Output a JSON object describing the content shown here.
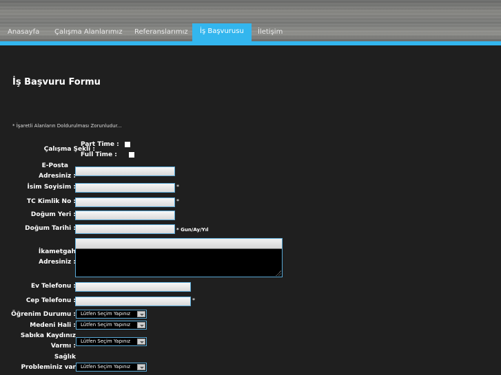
{
  "nav": {
    "items": [
      "Anasayfa",
      "Çalışma Alanlarımız",
      "Referanslarımız",
      "İş Başvurusu",
      "İletişim"
    ]
  },
  "form": {
    "title": "İş Başvuru Formu",
    "required_note": "* İşaretli Alanların Doldurulması Zorunludur...",
    "labels": {
      "calisma_sekli": "Çalışma Şekli :",
      "part_time": "Part Time  :",
      "full_time": "Full Time   :",
      "eposta_1": "E-Posta",
      "eposta_2": "Adresiniz :",
      "isim": "İsim Soyisim :",
      "tc": "TC Kimlik No :",
      "dogum_yeri": "Doğum Yeri :",
      "dogum_tarihi": "Doğum Tarihi :",
      "ikametgah_1": "İkametgah",
      "ikametgah_2": "Adresiniz :",
      "ev_tel": "Ev Telefonu :",
      "cep_tel": "Cep Telefonu :",
      "ogrenim": "Öğrenim Durumu :",
      "medeni": "Medeni Hali :",
      "sabika_1": "Sabıka Kaydınız",
      "sabika_2": "Varmı :",
      "saglik_1": "Sağlık",
      "saglik_2": "Probleminiz var"
    },
    "star": "*",
    "date_hint": "* Gun/Ay/Yıl",
    "select_placeholder": "Lütfen Seçim Yapınız"
  }
}
